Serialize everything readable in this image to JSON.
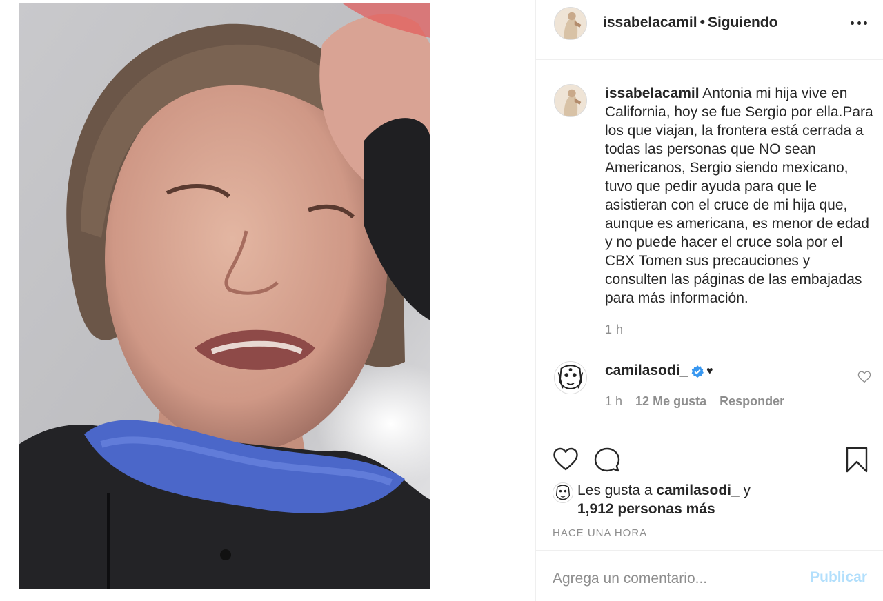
{
  "post": {
    "photo_name": "selfie-photo",
    "author": {
      "username": "issabelacamil",
      "separator": "•",
      "follow_status": "Siguiendo"
    }
  },
  "caption": {
    "username": "issabelacamil",
    "text": "Antonia mi hija vive en California, hoy se fue Sergio por ella.Para los que viajan, la frontera está cerrada a todas las personas que NO sean Americanos, Sergio siendo mexicano, tuvo que pedir ayuda para que le asistieran con el cruce de mi hija que, aunque es americana, es menor de edad y no puede hacer el cruce sola por el CBX Tomen sus precauciones y consulten las páginas de las embajadas para más información.",
    "time": "1 h"
  },
  "comments": [
    {
      "username": "camilasodi_",
      "verified": true,
      "text": "♥",
      "time": "1 h",
      "likes": "12 Me gusta",
      "reply": "Responder"
    }
  ],
  "likes": {
    "prefix": "Les gusta a",
    "user": "camilasodi_",
    "conjunction": "y",
    "count": "1,912 personas más"
  },
  "timestamp": "HACE UNA HORA",
  "add_comment": {
    "placeholder": "Agrega un comentario...",
    "publish_label": "Publicar"
  },
  "colors": {
    "verified": "#3897f0",
    "publish_disabled": "#b2dffc",
    "secondary_text": "#8e8e8e",
    "divider": "#efefef"
  },
  "icons": {
    "more": "more-options-icon",
    "like": "heart-outline-icon",
    "comment": "speech-bubble-icon",
    "save": "bookmark-icon",
    "verified": "verified-badge-icon"
  }
}
